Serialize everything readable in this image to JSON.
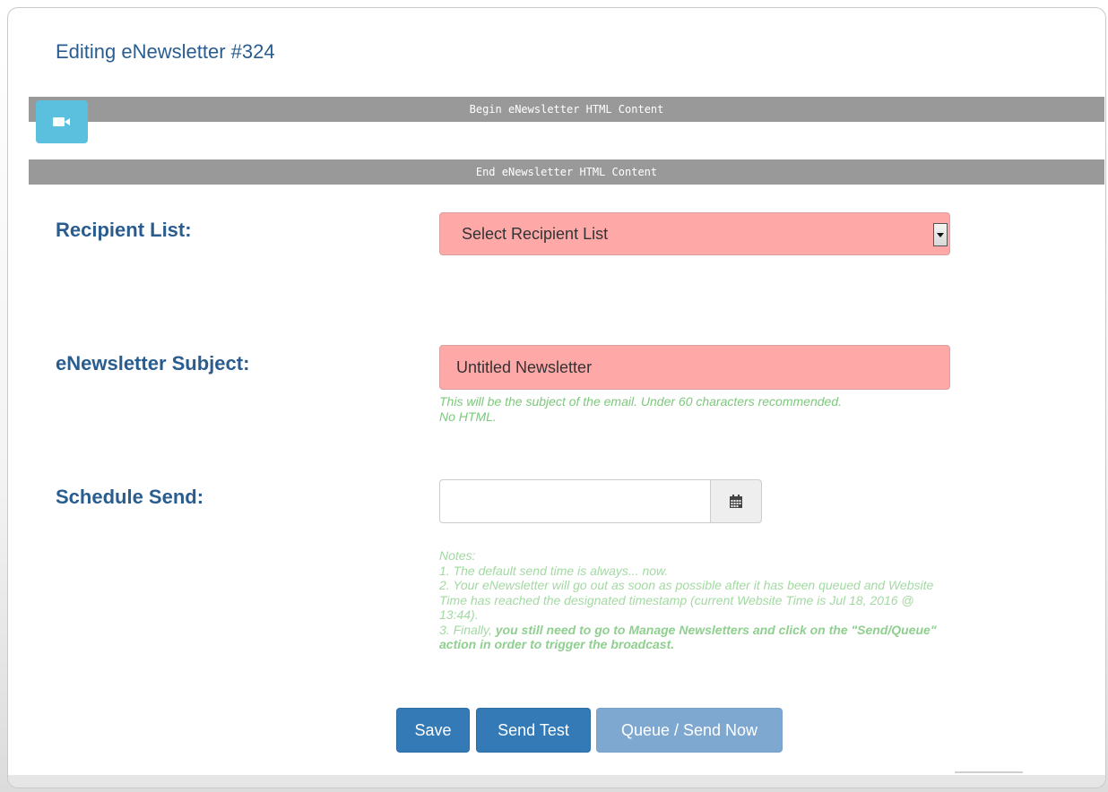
{
  "page": {
    "title": "Editing eNewsletter #324"
  },
  "content_bars": {
    "begin": "Begin eNewsletter HTML Content",
    "end": "End eNewsletter HTML Content"
  },
  "video_button": {
    "icon": "video-camera-icon",
    "color": "#5bc0de"
  },
  "recipient_list": {
    "label": "Recipient List:",
    "selected": "Select Recipient List",
    "background": "#ffa8a8"
  },
  "subject": {
    "label": "eNewsletter Subject:",
    "value": "Untitled Newsletter",
    "help_line1": "This will be the subject of the email. Under 60 characters recommended.",
    "help_line2": "No HTML."
  },
  "schedule": {
    "label": "Schedule Send:",
    "value": "",
    "calendar_icon": "calendar-icon"
  },
  "notes": {
    "heading": "Notes:",
    "line1": "1. The default send time is always... now.",
    "line2": "2. Your eNewsletter will go out as soon as possible after it has been queued and Website Time has reached the designated timestamp (current Website Time is Jul 18, 2016 @ 13:44).",
    "line3_prefix": "3. Finally, ",
    "line3_bold": "you still need to go to Manage Newsletters and click on the \"Send/Queue\" action in order to trigger the broadcast."
  },
  "buttons": {
    "save": "Save",
    "send_test": "Send Test",
    "queue_send": "Queue / Send Now"
  },
  "colors": {
    "title": "#2a5d8f",
    "primary_button": "#337ab7",
    "disabled_button": "#7fa8d0",
    "help_text": "#7dc87d",
    "bar": "#999999"
  }
}
